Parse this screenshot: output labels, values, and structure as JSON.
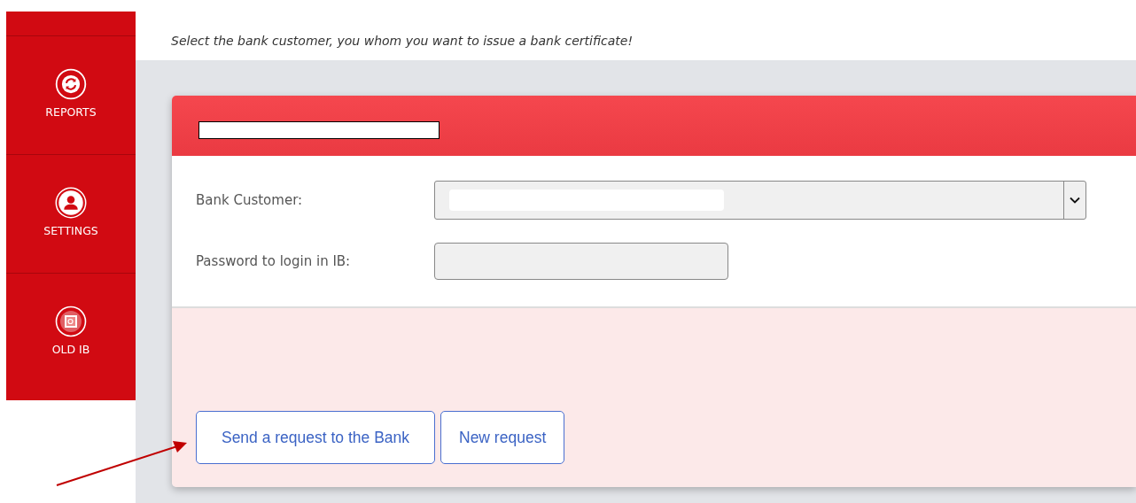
{
  "sidebar": {
    "items": [
      {
        "label": "REPORTS",
        "selected": false
      },
      {
        "label": "SETTINGS",
        "selected": false
      },
      {
        "label": "OLD IB",
        "selected": false
      }
    ]
  },
  "instruction": "Select the bank customer, you whom you want to issue a bank certificate!",
  "form": {
    "fields": [
      {
        "kind": "select",
        "label": "Bank Customer:"
      },
      {
        "kind": "password",
        "label": "Password to login in IB:"
      }
    ],
    "buttons": [
      "Send a request to the Bank",
      "New request"
    ]
  }
}
